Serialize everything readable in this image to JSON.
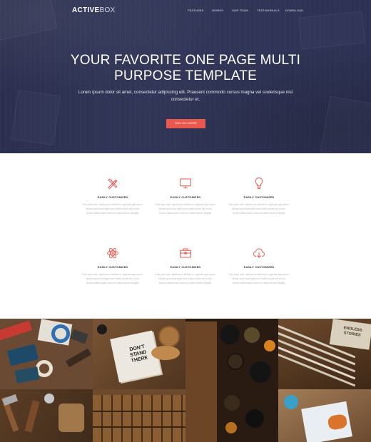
{
  "header": {
    "logo_bold": "ACTIVE",
    "logo_light": "BOX",
    "nav": [
      {
        "label": "FEATURES"
      },
      {
        "label": "WORKS"
      },
      {
        "label": "OUR TEAM"
      },
      {
        "label": "TESTIMONIALS"
      },
      {
        "label": "DOWNLOAD"
      }
    ]
  },
  "hero": {
    "title_line1": "YOUR FAVORITE ONE PAGE MULTI",
    "title_line2": "PURPOSE TEMPLATE",
    "subtitle": "Lorem ipsum dolor sit amet, consectetur adipiscing elit. Praesent commodo cursus magna vel scelerisque nisl consectetur et.",
    "cta_label": "FIND OUT MORE"
  },
  "features": [
    {
      "icon": "pencil-ruler-icon",
      "title": "EASILY CUSTOMIZED",
      "desc": "Duis justo odio, dapibus ac facilisis in, egestas eget quam. Nullam quis risus eget urna mollis ornare vel eu leo. Donec ullamcorper nulla non metus auctor fringilla."
    },
    {
      "icon": "monitor-icon",
      "title": "EASILY CUSTOMIZED",
      "desc": "Duis justo odio, dapibus ac facilisis in, egestas eget quam. Nullam quis risus eget urna mollis ornare vel eu leo. Donec ullamcorper nulla non metus auctor fringilla."
    },
    {
      "icon": "lightbulb-icon",
      "title": "EASILY CUSTOMIZED",
      "desc": "Duis justo odio, dapibus ac facilisis in, egestas eget quam. Nullam quis risus eget urna mollis ornare vel eu leo. Donec ullamcorper nulla non metus auctor fringilla."
    },
    {
      "icon": "atom-icon",
      "title": "EASILY CUSTOMIZED",
      "desc": "Duis justo odio, dapibus ac facilisis in, egestas eget quam. Nullam quis risus eget urna mollis ornare vel eu leo. Donec ullamcorper nulla non metus auctor fringilla."
    },
    {
      "icon": "briefcase-icon",
      "title": "EASILY CUSTOMIZED",
      "desc": "Duis justo odio, dapibus ac facilisis in, egestas eget quam. Nullam quis risus eget urna mollis ornare vel eu leo. Donec ullamcorper nulla non metus auctor fringilla."
    },
    {
      "icon": "cloud-download-icon",
      "title": "EASILY CUSTOMIZED",
      "desc": "Duis justo odio, dapibus ac facilisis in, egestas eget quam. Nullam quis risus eget urna mollis ornare vel eu leo. Donec ullamcorper nulla non metus auctor fringilla."
    }
  ],
  "gallery": {
    "tile_texts": [
      "DON'T STAND THERE",
      "ENDLESS STORIES"
    ]
  },
  "colors": {
    "hero_bg": "#2f3355",
    "accent": "#e8584e",
    "icon": "#e8584e"
  }
}
